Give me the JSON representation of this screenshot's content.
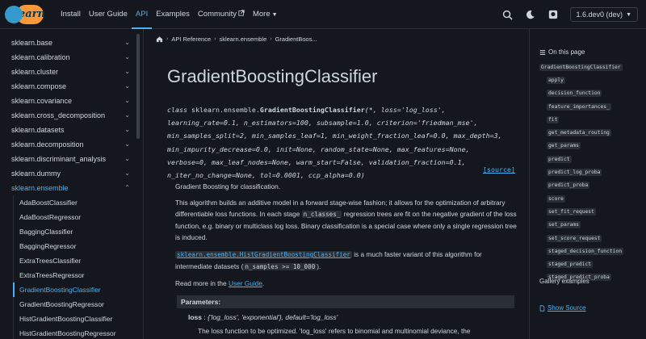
{
  "header": {
    "logo_text": "learn",
    "nav": [
      {
        "label": "Install",
        "active": false
      },
      {
        "label": "User Guide",
        "active": false
      },
      {
        "label": "API",
        "active": true
      },
      {
        "label": "Examples",
        "active": false
      },
      {
        "label": "Community",
        "active": false
      },
      {
        "label": "More",
        "active": false
      }
    ],
    "version": "1.6.dev0 (dev)"
  },
  "sidebar": {
    "items": [
      "sklearn.base",
      "sklearn.calibration",
      "sklearn.cluster",
      "sklearn.compose",
      "sklearn.covariance",
      "sklearn.cross_decomposition",
      "sklearn.datasets",
      "sklearn.decomposition",
      "sklearn.discriminant_analysis",
      "sklearn.dummy",
      "sklearn.ensemble"
    ],
    "ensemble_children": [
      "AdaBoostClassifier",
      "AdaBoostRegressor",
      "BaggingClassifier",
      "BaggingRegressor",
      "ExtraTreesClassifier",
      "ExtraTreesRegressor",
      "GradientBoostingClassifier",
      "GradientBoostingRegressor",
      "HistGradientBoostingClassifier",
      "HistGradientBoostingRegressor"
    ],
    "current": "GradientBoostingClassifier"
  },
  "breadcrumb": [
    "API Reference",
    "sklearn.ensemble",
    "GradientBoos..."
  ],
  "main": {
    "title": "GradientBoostingClassifier",
    "source_link": "[source]",
    "summary": "Gradient Boosting for classification.",
    "para1_a": "This algorithm builds an additive model in a forward stage-wise fashion; it allows for the optimization of arbitrary differentiable loss functions. In each stage ",
    "para1_code": "n_classes_",
    "para1_b": " regression trees are fit on the negative gradient of the loss function, e.g. binary or multiclass log loss. Binary classification is a special case where only a single regression tree is induced.",
    "para2_code": "sklearn.ensemble.HistGradientBoostingClassifier",
    "para2_a": " is a much faster variant of this algorithm for intermediate datasets (",
    "para2_code2": "n_samples >= 10_000",
    "para2_b": ").",
    "read_more_a": "Read more in the ",
    "read_more_link": "User Guide",
    "read_more_b": ".",
    "params_header": "Parameters:",
    "param_name": "loss",
    "param_sep": " : ",
    "param_type": "{'log_loss', 'exponential'}, default='log_loss'",
    "param_desc": "The loss function to be optimized. 'log_loss' refers to binomial and multinomial deviance, the"
  },
  "signature": {
    "l1_class": "class ",
    "l1_path": "sklearn.ensemble.",
    "l1_name": "GradientBoostingClassifier",
    "l1_rest": "(*, loss='log_loss',",
    "l2": "learning_rate=0.1, n_estimators=100, subsample=1.0, criterion='friedman_mse',",
    "l3": "min_samples_split=2, min_samples_leaf=1, min_weight_fraction_leaf=0.0, max_depth=3,",
    "l4": "min_impurity_decrease=0.0, init=None, random_state=None, max_features=None,",
    "l5": "verbose=0, max_leaf_nodes=None, warm_start=False, validation_fraction=0.1,",
    "l6": "n_iter_no_change=None, tol=0.0001, ccp_alpha=0.0)"
  },
  "toc": {
    "heading": "On this page",
    "top": "GradientBoostingClassifier",
    "methods": [
      "apply",
      "decision_function",
      "feature_importances_",
      "fit",
      "get_metadata_routing",
      "get_params",
      "predict",
      "predict_log_proba",
      "predict_proba",
      "score",
      "set_fit_request",
      "set_params",
      "set_score_request",
      "staged_decision_function",
      "staged_predict",
      "staged_predict_proba"
    ],
    "gallery": "Gallery examples",
    "show_source": "Show Source"
  }
}
